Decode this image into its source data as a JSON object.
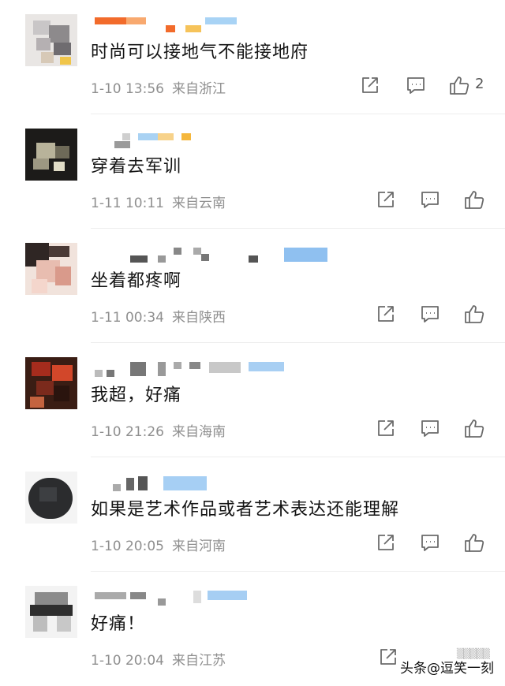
{
  "comments": [
    {
      "text": "时尚可以接地气不能接地府",
      "date": "1-10 13:56",
      "location": "来自浙江",
      "likes": "2"
    },
    {
      "text": "穿着去军训",
      "date": "1-11 10:11",
      "location": "来自云南",
      "likes": ""
    },
    {
      "text": "坐着都疼啊",
      "date": "1-11 00:34",
      "location": "来自陕西",
      "likes": ""
    },
    {
      "text": "我超，好痛",
      "date": "1-10 21:26",
      "location": "来自海南",
      "likes": ""
    },
    {
      "text": "如果是艺术作品或者艺术表达还能理解",
      "date": "1-10 20:05",
      "location": "来自河南",
      "likes": ""
    },
    {
      "text": "好痛！",
      "date": "1-10 20:04",
      "location": "来自江苏",
      "likes": ""
    }
  ],
  "watermark": "头条@逗笑一刻",
  "colors": {
    "text": "#141414",
    "meta": "#8f8f8f",
    "icon": "#6b6b6b",
    "divider": "#ededed"
  },
  "icons": [
    "share-icon",
    "comment-icon",
    "like-icon"
  ]
}
